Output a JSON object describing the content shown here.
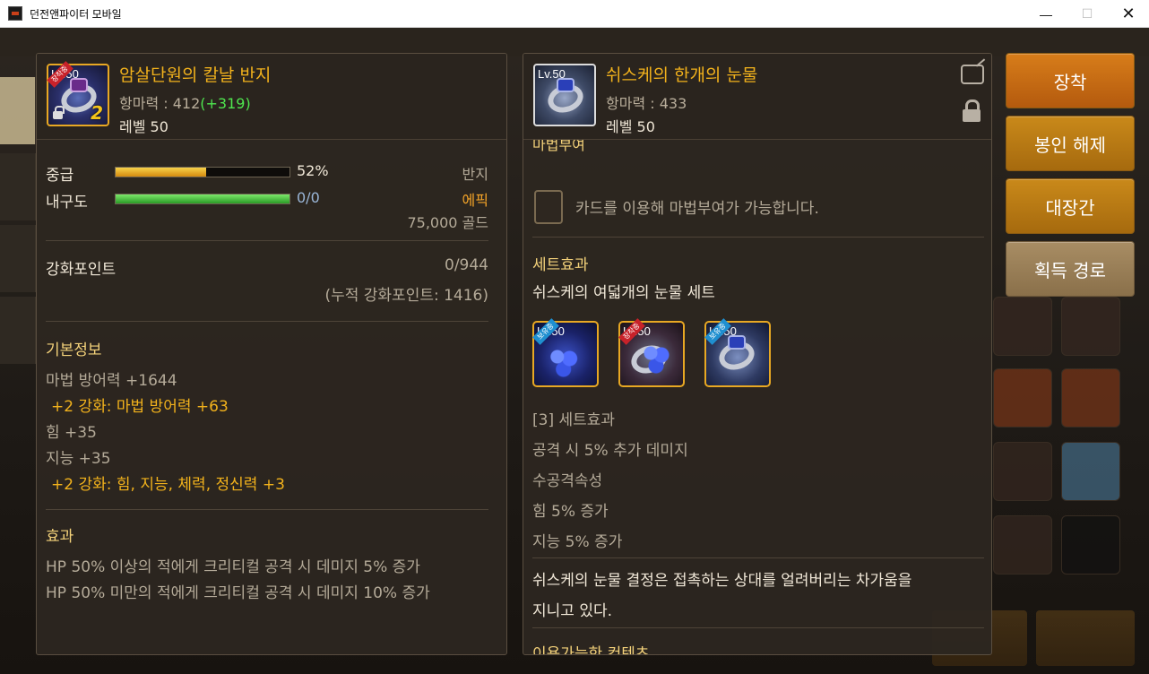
{
  "window": {
    "title": "던전앤파이터 모바일",
    "minimize": "—",
    "maximize": "☐",
    "close": "✕"
  },
  "left_item": {
    "name": "암살단원의 칼날 반지",
    "stat_label": "항마력 : 412",
    "stat_bonus": "(+319)",
    "level": "레벨 50",
    "level_tag": "Lv.50",
    "ribbon": "장착중",
    "enhance_badge": "2",
    "grade_label": "중급",
    "grade_value": "52%",
    "grade_fill": 0.52,
    "durability_label": "내구도",
    "durability_value": "0/0",
    "durability_fill": 1.0,
    "type": "반지",
    "rarity": "에픽",
    "price": "75,000 골드",
    "enhance_points_label": "강화포인트",
    "enhance_points_value": "0/944",
    "enhance_points_total": "(누적 강화포인트: 1416)",
    "basic_info_title": "기본정보",
    "basic_info": [
      "마법 방어력 +1644",
      "+2 강화: 마법 방어력 +63",
      "힘 +35",
      "지능 +35",
      "+2 강화: 힘, 지능, 체력, 정신력 +3"
    ],
    "effect_title": "효과",
    "effects": [
      "HP 50% 이상의 적에게 크리티컬 공격 시 데미지 5% 증가",
      "HP 50% 미만의 적에게 크리티컬 공격 시 데미지 10% 증가"
    ]
  },
  "right_item": {
    "name": "쉬스케의 한개의 눈물",
    "stat_label": "항마력 : 433",
    "level": "레벨 50",
    "level_tag": "Lv.50",
    "enchant_title_partial": "마법부여",
    "enchant_desc": "카드를 이용해 마법부여가 가능합니다.",
    "set_title": "세트효과",
    "set_name": "쉬스케의 여덟개의 눈물 세트",
    "set_items": [
      {
        "level_tag": "Lv.50",
        "ribbon": "보유중"
      },
      {
        "level_tag": "Lv.50",
        "ribbon": "장착중"
      },
      {
        "level_tag": "Lv.50",
        "ribbon": "보유중"
      }
    ],
    "set_effect_header": "[3] 세트효과",
    "set_effects": [
      "공격 시 5% 추가 데미지",
      "수공격속성",
      "힘 5% 증가",
      "지능 5% 증가"
    ],
    "flavor_line1": "쉬스케의 눈물 결정은 접촉하는 상대를 얼려버리는 차가움을",
    "flavor_line2": "지니고 있다.",
    "contents_title": "이용가능한 컨텐츠"
  },
  "buttons": {
    "equip": "장착",
    "unseal": "봉인 해제",
    "blacksmith": "대장간",
    "obtain_route": "획득 경로"
  }
}
